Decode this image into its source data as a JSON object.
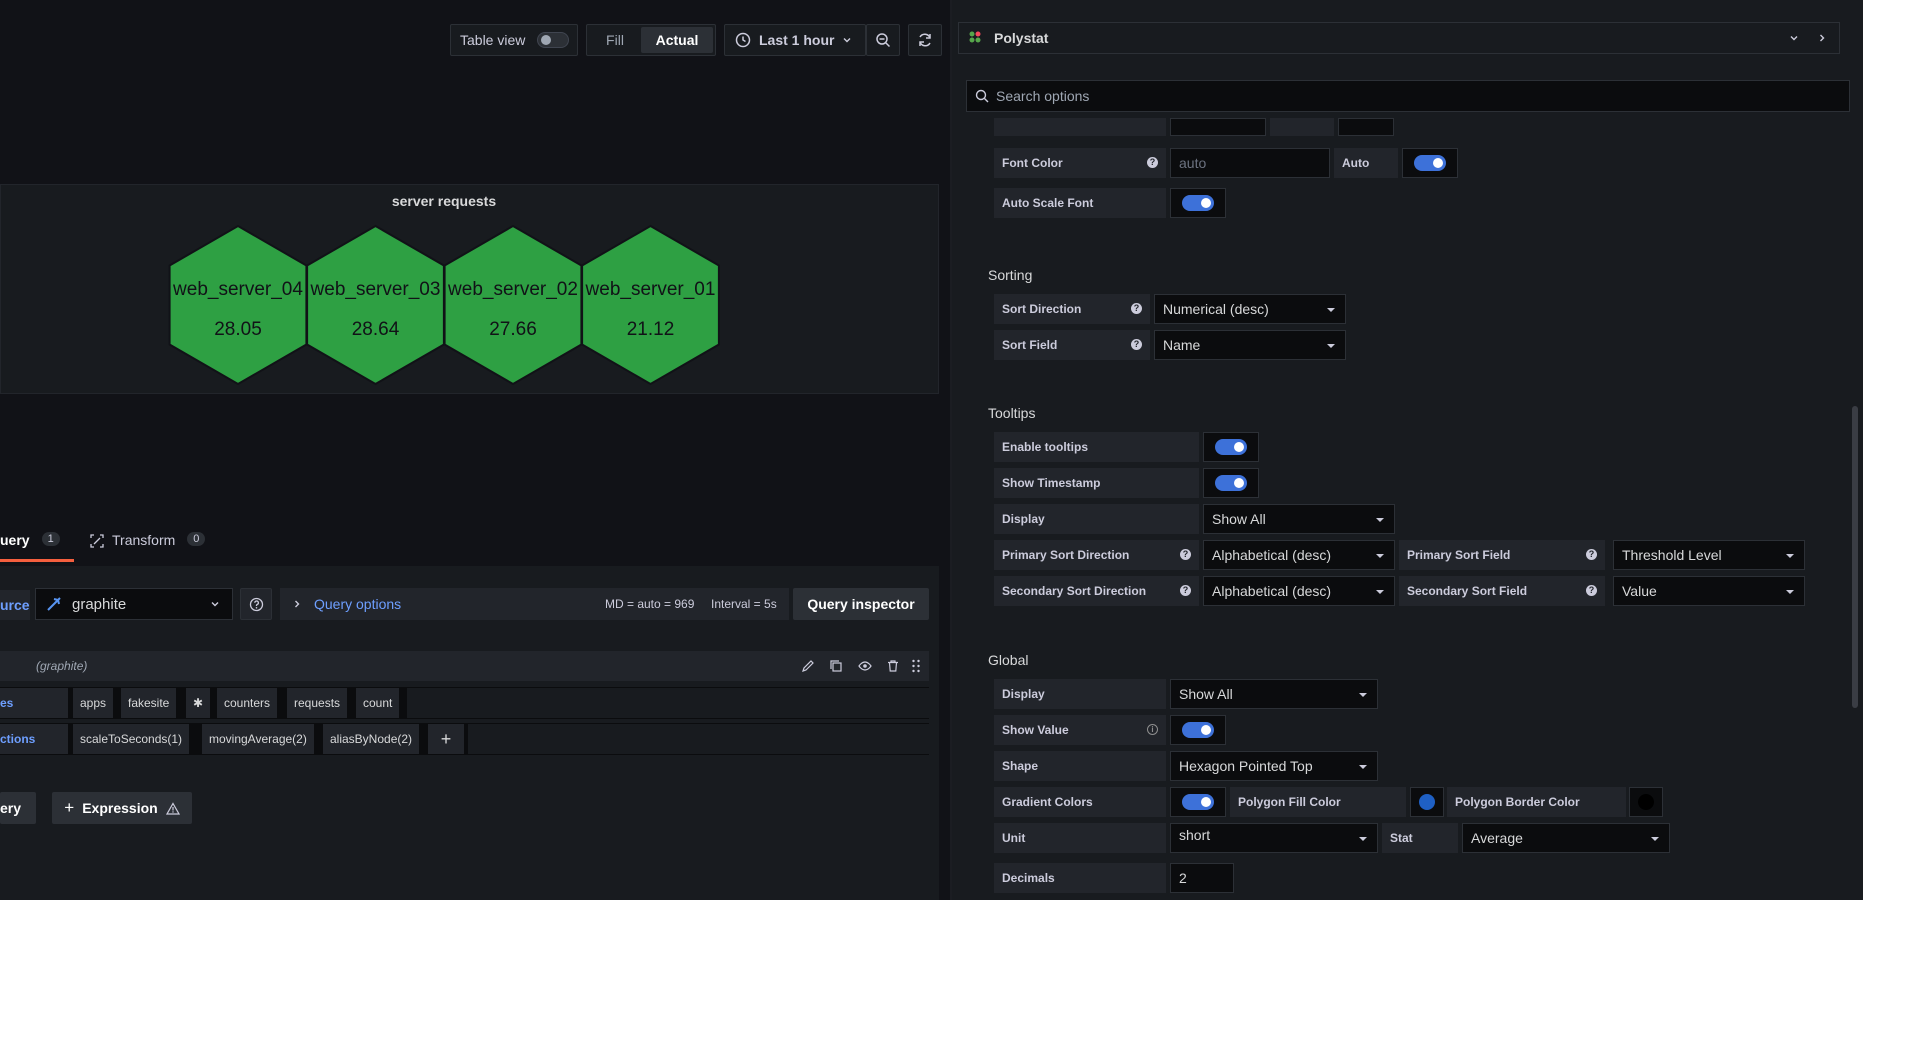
{
  "toolbar": {
    "table_view_label": "Table view",
    "fill_label": "Fill",
    "actual_label": "Actual",
    "time_range_label": "Last 1 hour"
  },
  "panel": {
    "title": "server requests",
    "hexes": [
      {
        "name": "web_server_04",
        "value": "28.05"
      },
      {
        "name": "web_server_03",
        "value": "28.64"
      },
      {
        "name": "web_server_02",
        "value": "27.66"
      },
      {
        "name": "web_server_01",
        "value": "21.12"
      }
    ],
    "hex_fill": "#2ea043",
    "hex_border": "#111217"
  },
  "query_tabs": {
    "query_label": "uery",
    "query_count": "1",
    "transform_label": "Transform",
    "transform_count": "0"
  },
  "datasource": {
    "prefix": "urce",
    "name": "graphite",
    "query_options_label": "Query options",
    "md_info": "MD = auto = 969",
    "interval_info": "Interval = 5s",
    "inspector_label": "Query inspector"
  },
  "query_row": {
    "name": "(graphite)",
    "series_label": "es",
    "series_tags": [
      "apps",
      "fakesite",
      "✱",
      "counters",
      "requests",
      "count"
    ],
    "functions_label": "ctions",
    "functions": [
      "scaleToSeconds(1)",
      "movingAverage(2)",
      "aliasByNode(2)"
    ],
    "add_label": "+"
  },
  "bottom_buttons": {
    "query_label": "ery",
    "expression_label": "Expression"
  },
  "options": {
    "viz_name": "Polystat",
    "search_placeholder": "Search options",
    "font_color_label": "Font Color",
    "font_color_placeholder": "auto",
    "auto_label": "Auto",
    "auto_scale_font_label": "Auto Scale Font",
    "sorting_title": "Sorting",
    "sort_direction_label": "Sort Direction",
    "sort_direction_value": "Numerical (desc)",
    "sort_field_label": "Sort Field",
    "sort_field_value": "Name",
    "tooltips_title": "Tooltips",
    "enable_tooltips_label": "Enable tooltips",
    "show_timestamp_label": "Show Timestamp",
    "tooltip_display_label": "Display",
    "tooltip_display_value": "Show All",
    "primary_sort_dir_label": "Primary Sort Direction",
    "primary_sort_dir_value": "Alphabetical (desc)",
    "primary_sort_field_label": "Primary Sort Field",
    "primary_sort_field_value": "Threshold Level",
    "secondary_sort_dir_label": "Secondary Sort Direction",
    "secondary_sort_dir_value": "Alphabetical (desc)",
    "secondary_sort_field_label": "Secondary Sort Field",
    "secondary_sort_field_value": "Value",
    "global_title": "Global",
    "global_display_label": "Display",
    "global_display_value": "Show All",
    "show_value_label": "Show Value",
    "shape_label": "Shape",
    "shape_value": "Hexagon Pointed Top",
    "gradient_colors_label": "Gradient Colors",
    "polygon_fill_label": "Polygon Fill Color",
    "polygon_fill_color": "#1f60c4",
    "polygon_border_label": "Polygon Border Color",
    "polygon_border_color": "#000000",
    "unit_label": "Unit",
    "unit_value": "short",
    "stat_label": "Stat",
    "stat_value": "Average",
    "decimals_label": "Decimals",
    "decimals_value": "2"
  }
}
